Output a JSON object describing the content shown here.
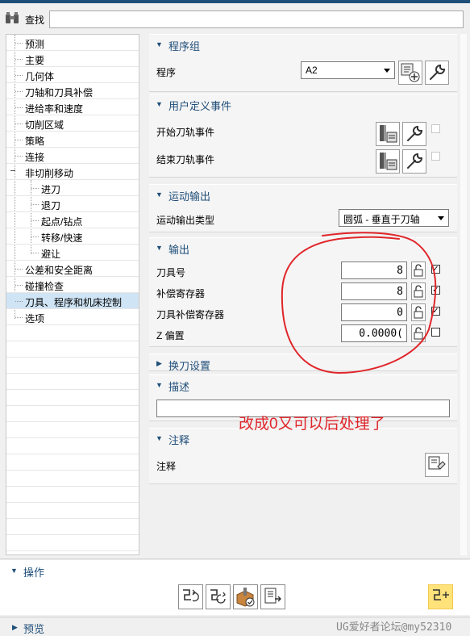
{
  "search": {
    "label": "查找",
    "value": ""
  },
  "tree": {
    "items": [
      {
        "label": "预测"
      },
      {
        "label": "主要"
      },
      {
        "label": "几何体"
      },
      {
        "label": "刀轴和刀具补偿"
      },
      {
        "label": "进给率和速度"
      },
      {
        "label": "切削区域"
      },
      {
        "label": "策略"
      },
      {
        "label": "连接"
      },
      {
        "label": "非切削移动",
        "expanded": true
      },
      {
        "label": "进刀"
      },
      {
        "label": "退刀"
      },
      {
        "label": "起点/钻点"
      },
      {
        "label": "转移/快速"
      },
      {
        "label": "避让"
      },
      {
        "label": "公差和安全距离"
      },
      {
        "label": "碰撞检查"
      },
      {
        "label": "刀具、程序和机床控制",
        "selected": true
      },
      {
        "label": "选项"
      }
    ]
  },
  "sections": {
    "program_group": {
      "title": "程序组",
      "program_label": "程序",
      "program_value": "A2"
    },
    "user_events": {
      "title": "用户定义事件",
      "start_label": "开始刀轨事件",
      "end_label": "结束刀轨事件"
    },
    "motion_output": {
      "title": "运动输出",
      "type_label": "运动输出类型",
      "type_value": "圆弧 - 垂直于刀轴"
    },
    "output": {
      "title": "输出",
      "rows": [
        {
          "label": "刀具号",
          "value": "8",
          "checked": true
        },
        {
          "label": "补偿寄存器",
          "value": "8",
          "checked": true
        },
        {
          "label": "刀具补偿寄存器",
          "value": "0",
          "checked": true
        },
        {
          "label": "Z 偏置",
          "value": "0.0000(",
          "checked": false
        }
      ]
    },
    "tool_change": {
      "title": "换刀设置"
    },
    "description": {
      "title": "描述",
      "value": ""
    },
    "notes": {
      "title": "注释",
      "label": "注释"
    }
  },
  "annotation": {
    "text": "改成0又可以后处理了",
    "color": "#e0262b"
  },
  "operations": {
    "title": "操作"
  },
  "preview": {
    "title": "预览"
  },
  "watermark": "UG爱好者论坛@my52310"
}
